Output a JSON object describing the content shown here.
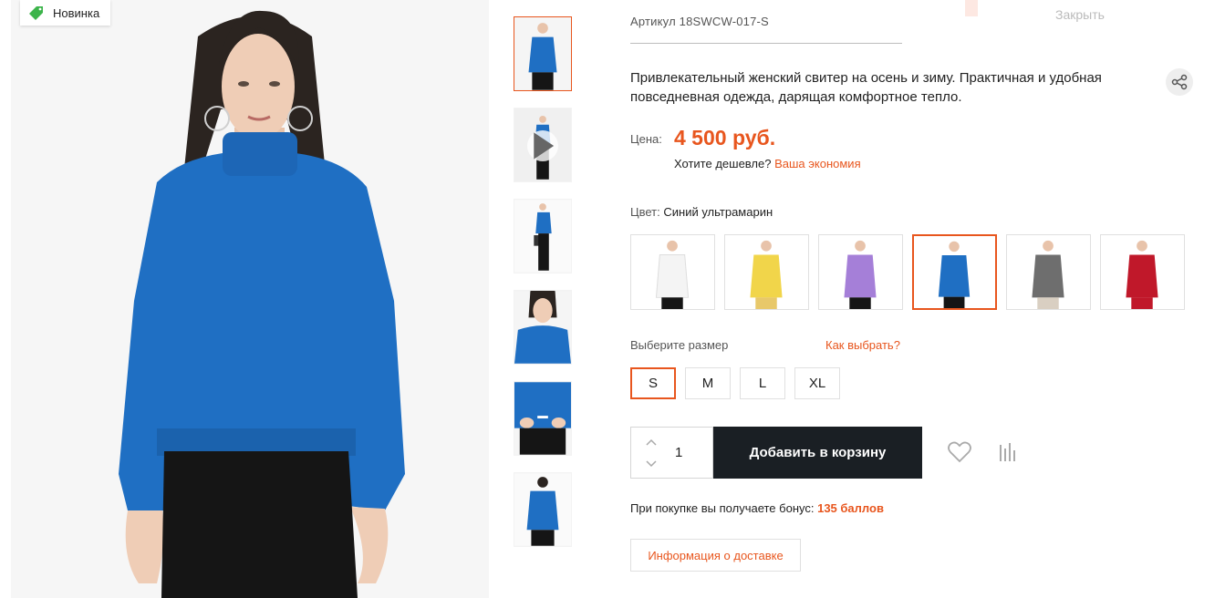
{
  "badge": {
    "label": "Новинка",
    "icon": "tag-icon",
    "color": "#3cb44b"
  },
  "close": {
    "label": "Закрыть"
  },
  "product": {
    "sku": "Артикул 18SWCW-017-S",
    "description": "Привлекательный женский свитер на осень и зиму. Практичная и удобная повседневная одежда, дарящая комфортное тепло.",
    "price_label": "Цена:",
    "price": "4 500 руб.",
    "cheaper_text": "Хотите дешевле?",
    "cheaper_link": "Ваша экономия",
    "color_label": "Цвет:",
    "color_value": "Синий ультрамарин",
    "size_label": "Выберите размер",
    "size_help": "Как выбрать?",
    "sizes": [
      "S",
      "M",
      "L",
      "XL"
    ],
    "selected_size": "S",
    "quantity": "1",
    "add_to_cart": "Добавить в корзину",
    "bonus_text": "При покупке вы получаете бонус:",
    "bonus_points": "135 баллов",
    "delivery_info": "Информация о доставке"
  },
  "swatches": [
    {
      "name": "white",
      "color": "#f4f4f4"
    },
    {
      "name": "yellow",
      "color": "#f1d54a"
    },
    {
      "name": "lilac",
      "color": "#a57fd8"
    },
    {
      "name": "blue",
      "color": "#1f6fc3",
      "active": true
    },
    {
      "name": "grey",
      "color": "#6e6e6e"
    },
    {
      "name": "red",
      "color": "#c0182a"
    }
  ],
  "thumbnails": [
    "front",
    "video",
    "side-bag",
    "close-up",
    "detail",
    "back"
  ],
  "colors": {
    "accent": "#e8561e",
    "button": "#1a1f24",
    "sweater": "#1f6fc3"
  }
}
